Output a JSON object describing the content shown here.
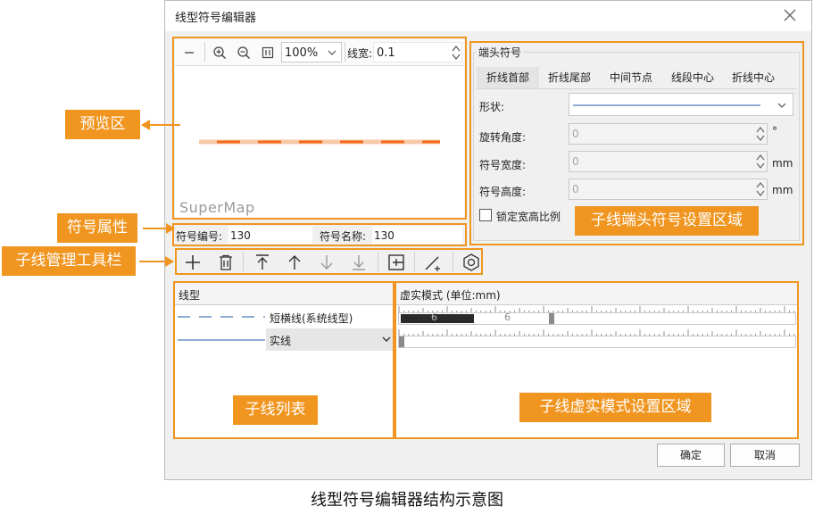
{
  "dialog": {
    "title": "线型符号编辑器",
    "ok_label": "确定",
    "cancel_label": "取消"
  },
  "preview": {
    "zoom_value": "100%",
    "width_label": "线宽:",
    "width_value": "0.1",
    "watermark": "SuperMap"
  },
  "symbol_props": {
    "id_label": "符号编号:",
    "id_value": "130",
    "name_label": "符号名称:",
    "name_value": "130"
  },
  "end_symbol": {
    "group_title": "端头符号",
    "tabs": [
      "折线首部",
      "折线尾部",
      "中间节点",
      "线段中心",
      "折线中心"
    ],
    "shape_label": "形状:",
    "rotation_label": "旋转角度:",
    "rotation_value": "0",
    "rotation_unit": "°",
    "width_label": "符号宽度:",
    "width_value": "0",
    "width_unit": "mm",
    "height_label": "符号高度:",
    "height_value": "0",
    "height_unit": "mm",
    "lock_label": "锁定宽高比例"
  },
  "sublines": {
    "header": "线型",
    "rows": [
      {
        "label": "短横线(系统线型)"
      },
      {
        "label": "实线"
      }
    ]
  },
  "dash_pattern": {
    "header": "虚实模式 (单位:mm)",
    "row1": {
      "solid": "6",
      "gap": "6"
    }
  },
  "callouts": {
    "preview": "预览区",
    "symbol_props": "符号属性",
    "toolbar": "子线管理工具栏",
    "end_symbol": "子线端头符号设置区域",
    "subline_list": "子线列表",
    "dash_area": "子线虚实模式设置区域"
  },
  "caption": "线型符号编辑器结构示意图",
  "colors": {
    "accent": "#f0951f",
    "line_orange": "#f26a1b",
    "line_blue": "#6b8fc7"
  }
}
